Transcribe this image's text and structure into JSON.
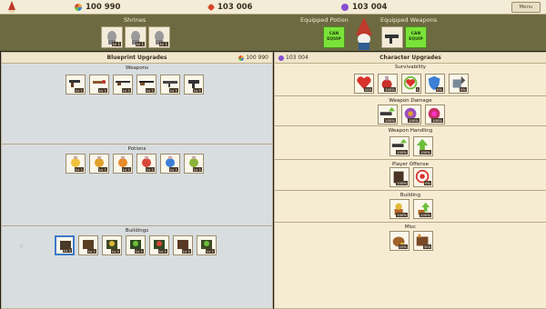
{
  "topbar": {
    "currencies": [
      {
        "icon": "blueprint-coin-icon",
        "value": "100 990",
        "color": "#c98a2a"
      },
      {
        "icon": "ruby-gem-icon",
        "value": "103 006",
        "color": "#d8462a"
      },
      {
        "icon": "purple-gem-icon",
        "value": "103 004",
        "color": "#8a4fd1"
      }
    ],
    "menu_label": "Menu"
  },
  "header": {
    "shrines_title": "Shrines",
    "equipped_potion_title": "Equipped Potion",
    "equipped_weapons_title": "Equipped Weapons",
    "can_equip_label": "CAN EQUIP",
    "shrines": [
      {
        "level": "Lv 1"
      },
      {
        "level": "Lv 1"
      },
      {
        "level": "Lv 1"
      }
    ]
  },
  "left_panel": {
    "title": "Blueprint Upgrades",
    "currency_value": "100 990",
    "sections": {
      "weapons": {
        "title": "Weapons",
        "items": [
          "Lv 1",
          "Lv 1",
          "Lv 1",
          "Lv 1",
          "Lv 1",
          "Lv 1"
        ]
      },
      "potions": {
        "title": "Potions",
        "items": [
          "Lv 1",
          "Lv 1",
          "Lv 1",
          "Lv 1",
          "Lv 1",
          "Lv 1"
        ]
      },
      "buildings": {
        "title": "Buildings",
        "items": [
          "Lv 1",
          "Lv 1",
          "Lv 1",
          "Lv 1",
          "Lv 1",
          "Lv 1",
          "Lv 1"
        ]
      }
    }
  },
  "right_panel": {
    "title": "Character Upgrades",
    "currency_value": "103 004",
    "sections": {
      "survivability": {
        "title": "Survivability",
        "items": [
          "100",
          "100%",
          "0",
          "0%",
          "0%"
        ]
      },
      "weapon_damage": {
        "title": "Weapon Damage",
        "items": [
          "100%",
          "100%",
          "100%"
        ]
      },
      "weapon_handling": {
        "title": "Weapon Handling",
        "items": [
          "100%",
          "100%"
        ]
      },
      "player_offense": {
        "title": "Player Offense",
        "items": [
          "100%",
          "0%"
        ]
      },
      "building": {
        "title": "Building",
        "items": [
          "100%",
          "100%"
        ]
      },
      "misc": {
        "title": "Misc",
        "items": [
          "20%",
          "300"
        ]
      }
    }
  }
}
